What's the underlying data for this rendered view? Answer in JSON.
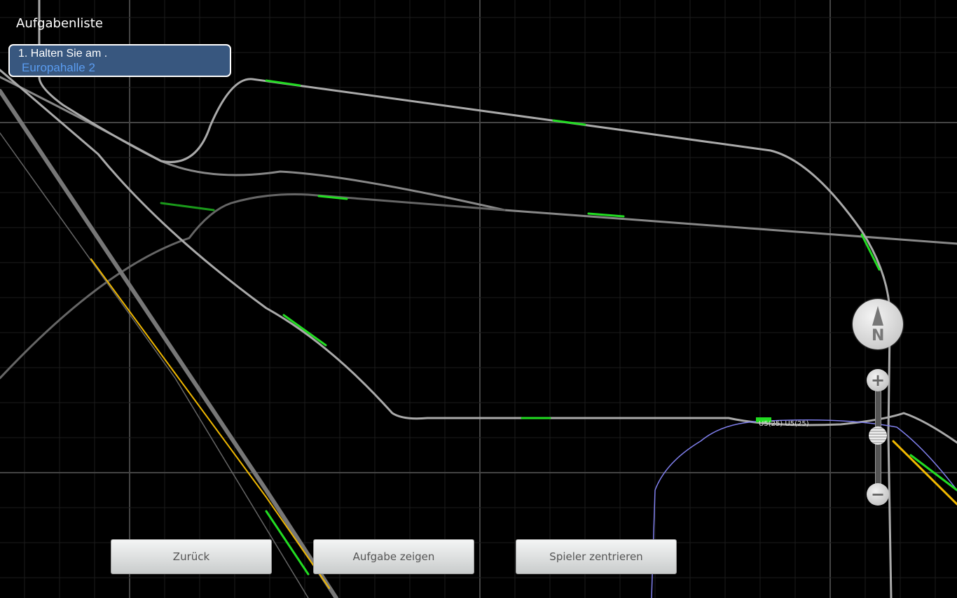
{
  "task_list": {
    "title": "Aufgabenliste",
    "tasks": [
      {
        "text": "1. Halten Sie am .",
        "station": "Europahalle 2"
      }
    ]
  },
  "buttons": {
    "back": "Zurück",
    "show_task": "Aufgabe zeigen",
    "center_player": "Spieler zentrieren"
  },
  "compass": {
    "label": "N"
  },
  "zoom": {
    "plus": "+",
    "minus": "−",
    "level": 0.5
  },
  "train_labels": [
    "U5(25)",
    "U5(25)"
  ],
  "colors": {
    "track": "#b5b5b5",
    "track_dark": "#555555",
    "signal_green": "#22dd22",
    "route_yellow": "#f0b800",
    "route_blue": "#8080ee",
    "panel": "#38577f"
  }
}
